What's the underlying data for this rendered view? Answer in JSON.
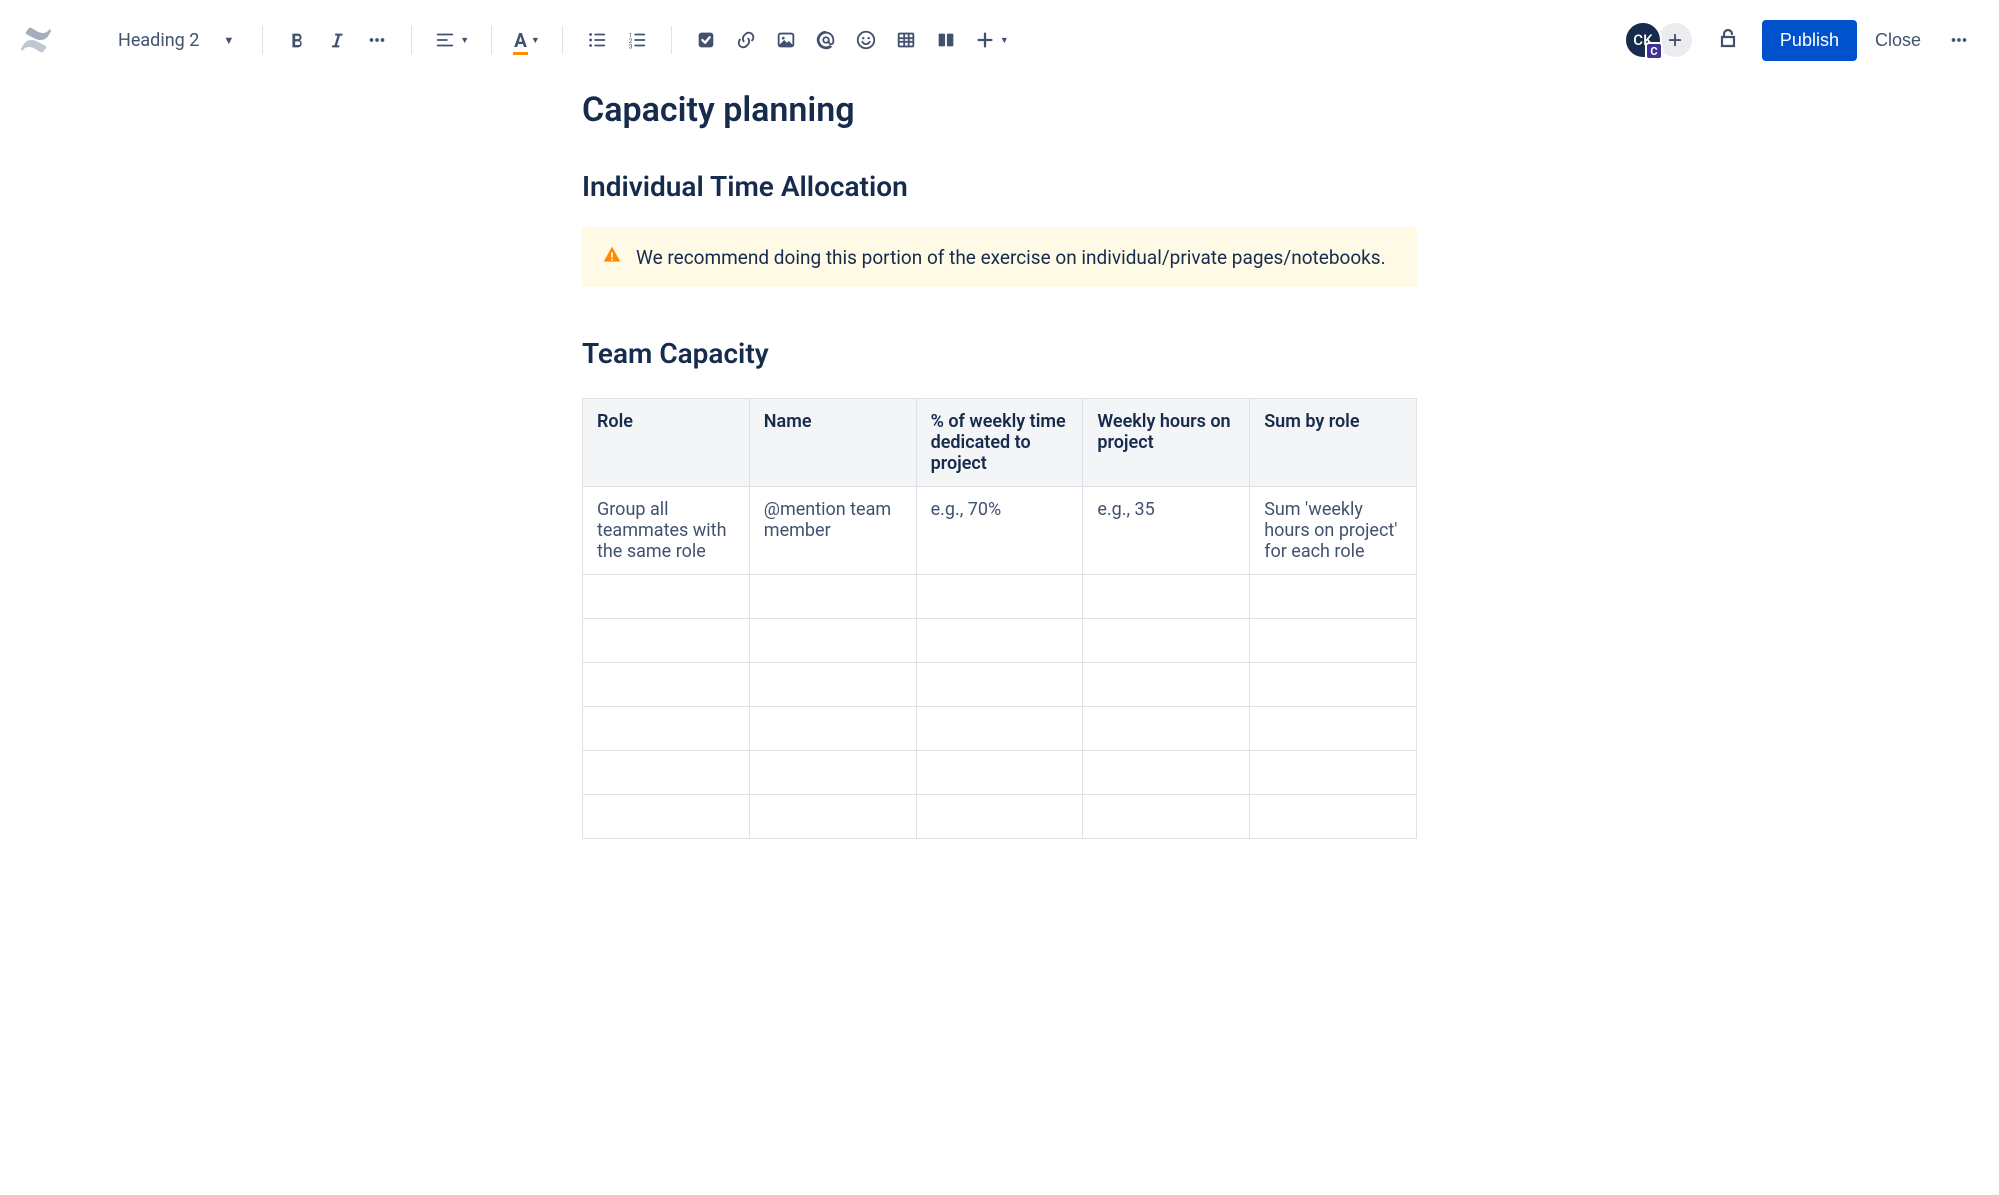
{
  "toolbar": {
    "heading_selector": "Heading 2"
  },
  "avatar": {
    "initials": "CK",
    "badge": "C"
  },
  "actions": {
    "publish": "Publish",
    "close": "Close"
  },
  "page": {
    "title": "Capacity planning",
    "h2_a": "Individual Time Allocation",
    "h2_b": "Team Capacity"
  },
  "panel": {
    "text": "We recommend doing this portion of the exercise on individual/private pages/notebooks."
  },
  "table": {
    "headers": [
      "Role",
      "Name",
      "% of weekly time dedicated to project",
      "Weekly hours on project",
      "Sum by role"
    ],
    "rows": [
      [
        "Group all teammates with the same role",
        "@mention team member",
        "e.g., 70%",
        "e.g., 35",
        "Sum 'weekly hours on project' for each role"
      ],
      [
        "",
        "",
        "",
        "",
        ""
      ],
      [
        "",
        "",
        "",
        "",
        ""
      ],
      [
        "",
        "",
        "",
        "",
        ""
      ],
      [
        "",
        "",
        "",
        "",
        ""
      ],
      [
        "",
        "",
        "",
        "",
        ""
      ],
      [
        "",
        "",
        "",
        "",
        ""
      ]
    ]
  }
}
